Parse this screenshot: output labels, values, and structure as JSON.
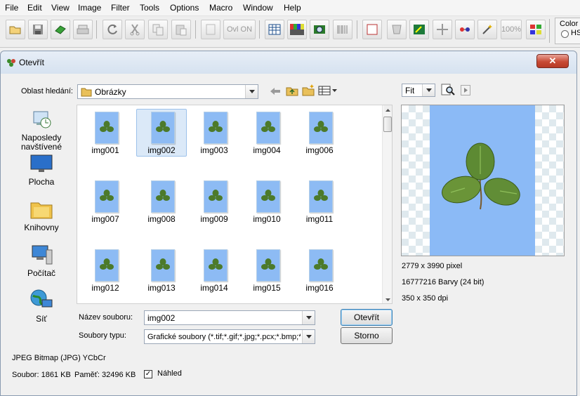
{
  "menu": [
    "File",
    "Edit",
    "View",
    "Image",
    "Filter",
    "Tools",
    "Options",
    "Macro",
    "Window",
    "Help"
  ],
  "toolbar": {
    "rgb_label": "Ovl ON",
    "zoom_label": "100%",
    "color_section_label": "Color S",
    "hs_label": "HS"
  },
  "dialog": {
    "title": "Otevřít",
    "look_in_label": "Oblast hledání:",
    "look_in_value": "Obrázky",
    "places": [
      {
        "label": "Naposledy navštívené",
        "icon": "recent-places-icon"
      },
      {
        "label": "Plocha",
        "icon": "desktop-icon"
      },
      {
        "label": "Knihovny",
        "icon": "libraries-icon"
      },
      {
        "label": "Počítač",
        "icon": "computer-icon"
      },
      {
        "label": "Síť",
        "icon": "network-icon"
      }
    ],
    "files": [
      "img001",
      "img002",
      "img003",
      "img004",
      "img006",
      "img007",
      "img008",
      "img009",
      "img010",
      "img011",
      "img012",
      "img013",
      "img014",
      "img015",
      "img016"
    ],
    "selected_file": "img002",
    "filename_label": "Název souboru:",
    "filename_value": "img002",
    "filetype_label": "Soubory typu:",
    "filetype_value": "Grafické soubory (*.tif;*.gif;*.jpg;*.pcx;*.bmp;*.ico",
    "open_button": "Otevřít",
    "cancel_button": "Storno",
    "format_info": "JPEG Bitmap (JPG) YCbCr",
    "file_size": "Soubor: 1861 KB",
    "memory_size": "Paměť: 32496 KB",
    "preview_checkbox_label": "Náhled",
    "preview_checked": true,
    "fit_value": "Fit",
    "image_dimensions": "2779 x 3990 pixel",
    "image_colors": "16777216 Barvy (24 bit)",
    "image_dpi": "350 x 350 dpi"
  }
}
